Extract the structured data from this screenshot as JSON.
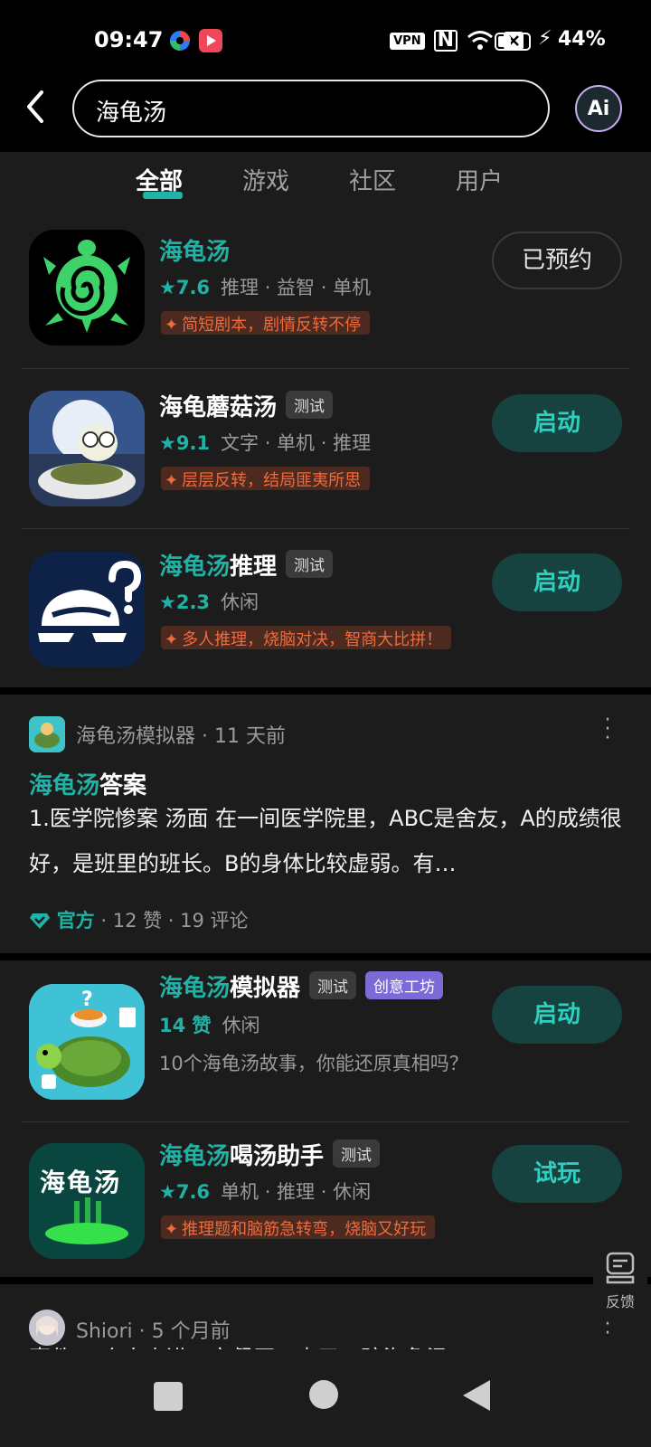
{
  "status_bar": {
    "time": "09:47",
    "vpn": "VPN",
    "nfc": "N",
    "battery_pct": "44%",
    "battery_level": 0.44
  },
  "search": {
    "query": "海龟汤",
    "ai_label": "Ai"
  },
  "tabs": [
    {
      "label": "全部",
      "active": true
    },
    {
      "label": "游戏",
      "active": false
    },
    {
      "label": "社区",
      "active": false
    },
    {
      "label": "用户",
      "active": false
    }
  ],
  "apps": [
    {
      "title_hl": "海龟汤",
      "title_rest": "",
      "badge": "",
      "score": "★7.6",
      "tags": "推理 · 益智 · 单机",
      "tagline": "简短剧本，剧情反转不停",
      "action": "已预约"
    },
    {
      "title_hl": "",
      "title_rest": "海龟蘑菇汤",
      "badge": "测试",
      "score": "★9.1",
      "tags": "文字 · 单机 · 推理",
      "tagline": "层层反转，结局匪夷所思",
      "action": "启动"
    },
    {
      "title_hl": "海龟汤",
      "title_rest": "推理",
      "badge": "测试",
      "score": "★2.3",
      "tags": "休闲",
      "tagline": "多人推理，烧脑对决，智商大比拼！",
      "action": "启动"
    }
  ],
  "post1": {
    "author_meta": "海龟汤模拟器 · 11 天前",
    "title_hl": "海龟汤",
    "title_rest": "答案",
    "body": "1.医学院惨案  汤面 在一间医学院里，ABC是舍友，A的成绩很好，是班里的班长。B的身体比较虚弱。有…",
    "official": "官方",
    "stats": " · 12 赞 · 19 评论"
  },
  "apps2": [
    {
      "title_hl": "海龟汤",
      "title_rest": "模拟器",
      "badge": "测试",
      "badge2": "创意工坊",
      "score": "14 赞",
      "tags": "休闲",
      "desc": "10个海龟汤故事，你能还原真相吗？",
      "action": "启动"
    },
    {
      "title_hl": "海龟汤",
      "title_rest": "喝汤助手",
      "badge": "测试",
      "score": "★7.6",
      "tags": "单机 · 推理 · 休闲",
      "tagline": "推理题和脑筋急转弯，烧脑又好玩",
      "action": "试玩",
      "icon_text": "海龟汤"
    }
  ],
  "post2": {
    "author_meta": "Shiori · 5 个月前",
    "partial": "事件 一个人走进一家餐厅，点了一碗海龟汤"
  },
  "feedback": "反馈"
}
